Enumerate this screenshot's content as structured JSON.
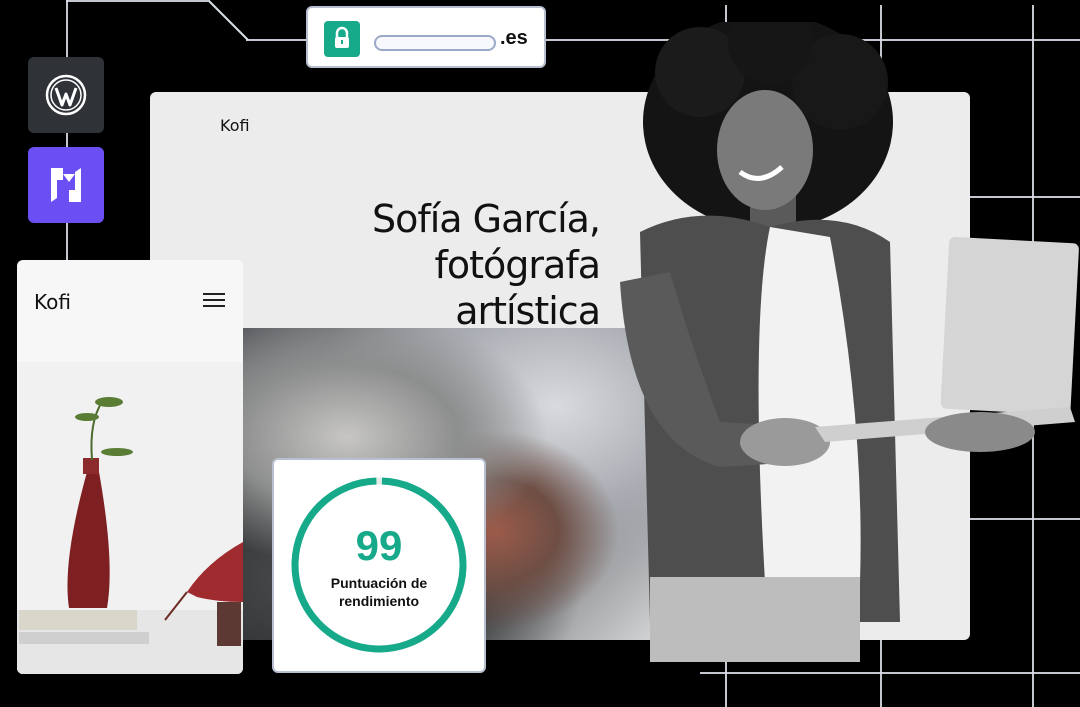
{
  "domain_bar": {
    "tld": ".es",
    "lock_icon": "lock-icon"
  },
  "tiles": [
    {
      "icon": "wordpress-icon",
      "color": "#2f3338"
    },
    {
      "icon": "hosting-logo-icon",
      "color": "#6c4ff3"
    }
  ],
  "desktop_site": {
    "brand": "Kofi",
    "hero_line1": "Sofía García,",
    "hero_line2": "fotógrafa artística"
  },
  "mobile_site": {
    "brand": "Kofi",
    "menu_icon": "hamburger-menu-icon"
  },
  "score": {
    "value": "99",
    "label_line1": "Puntuación de",
    "label_line2": "rendimiento",
    "accent": "#16a98a"
  }
}
